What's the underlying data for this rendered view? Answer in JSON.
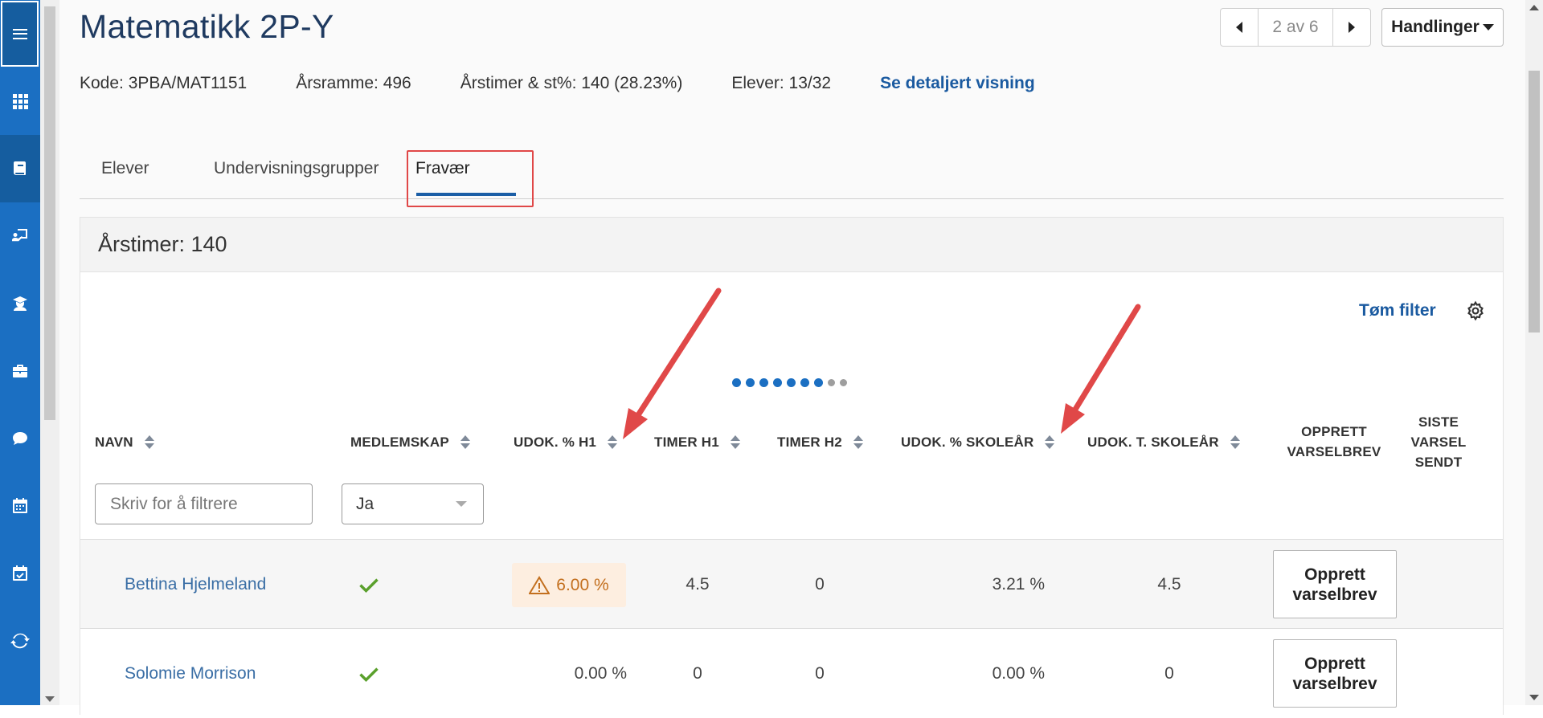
{
  "page": {
    "title": "Matematikk 2P-Y",
    "pager": {
      "count": "2 av 6"
    },
    "actions_label": "Handlinger"
  },
  "meta": {
    "kode": "Kode: 3PBA/MAT1151",
    "arsramme": "Årsramme: 496",
    "arstimer": "Årstimer & st%: 140 (28.23%)",
    "elever": "Elever: 13/32",
    "detail_link": "Se detaljert visning"
  },
  "tabs": [
    {
      "label": "Elever"
    },
    {
      "label": "Undervisningsgrupper"
    },
    {
      "label": "Fravær",
      "active": true
    }
  ],
  "panel": {
    "title": "Årstimer: 140",
    "clear_filter": "Tøm filter",
    "dots": {
      "total": 9,
      "active": 7
    }
  },
  "table": {
    "columns": [
      "NAVN",
      "MEDLEMSKAP",
      "UDOK. % H1",
      "TIMER H1",
      "TIMER H2",
      "UDOK. % SKOLEÅR",
      "UDOK. T. SKOLEÅR",
      "OPPRETT VARSELBREV",
      "SISTE VARSEL SENDT"
    ],
    "filters": {
      "name_placeholder": "Skriv for å filtrere",
      "membership_value": "Ja"
    },
    "rows": [
      {
        "name": "Bettina Hjelmeland",
        "member": true,
        "udok_h1": "6.00 %",
        "udok_h1_warning": true,
        "timer_h1": "4.5",
        "timer_h2": "0",
        "udok_year": "3.21 %",
        "udok_t_year": "4.5",
        "button": "Opprett varselbrev"
      },
      {
        "name": "Solomie Morrison",
        "member": true,
        "udok_h1": "0.00 %",
        "udok_h1_warning": false,
        "timer_h1": "0",
        "timer_h2": "0",
        "udok_year": "0.00 %",
        "udok_t_year": "0",
        "button": "Opprett varselbrev"
      }
    ]
  },
  "colors": {
    "nav_blue": "#1b6fc2",
    "link_blue": "#1a5aa0",
    "annotation_red": "#e04848",
    "warning_orange": "#c36f1e",
    "check_green": "#5aa02c"
  },
  "icons": {
    "nav": [
      "menu-icon",
      "apps-grid-icon",
      "book-icon",
      "teacher-board-icon",
      "student-icon",
      "briefcase-icon",
      "chat-icon",
      "calendar-icon",
      "calendar-check-icon",
      "sync-icon"
    ]
  }
}
